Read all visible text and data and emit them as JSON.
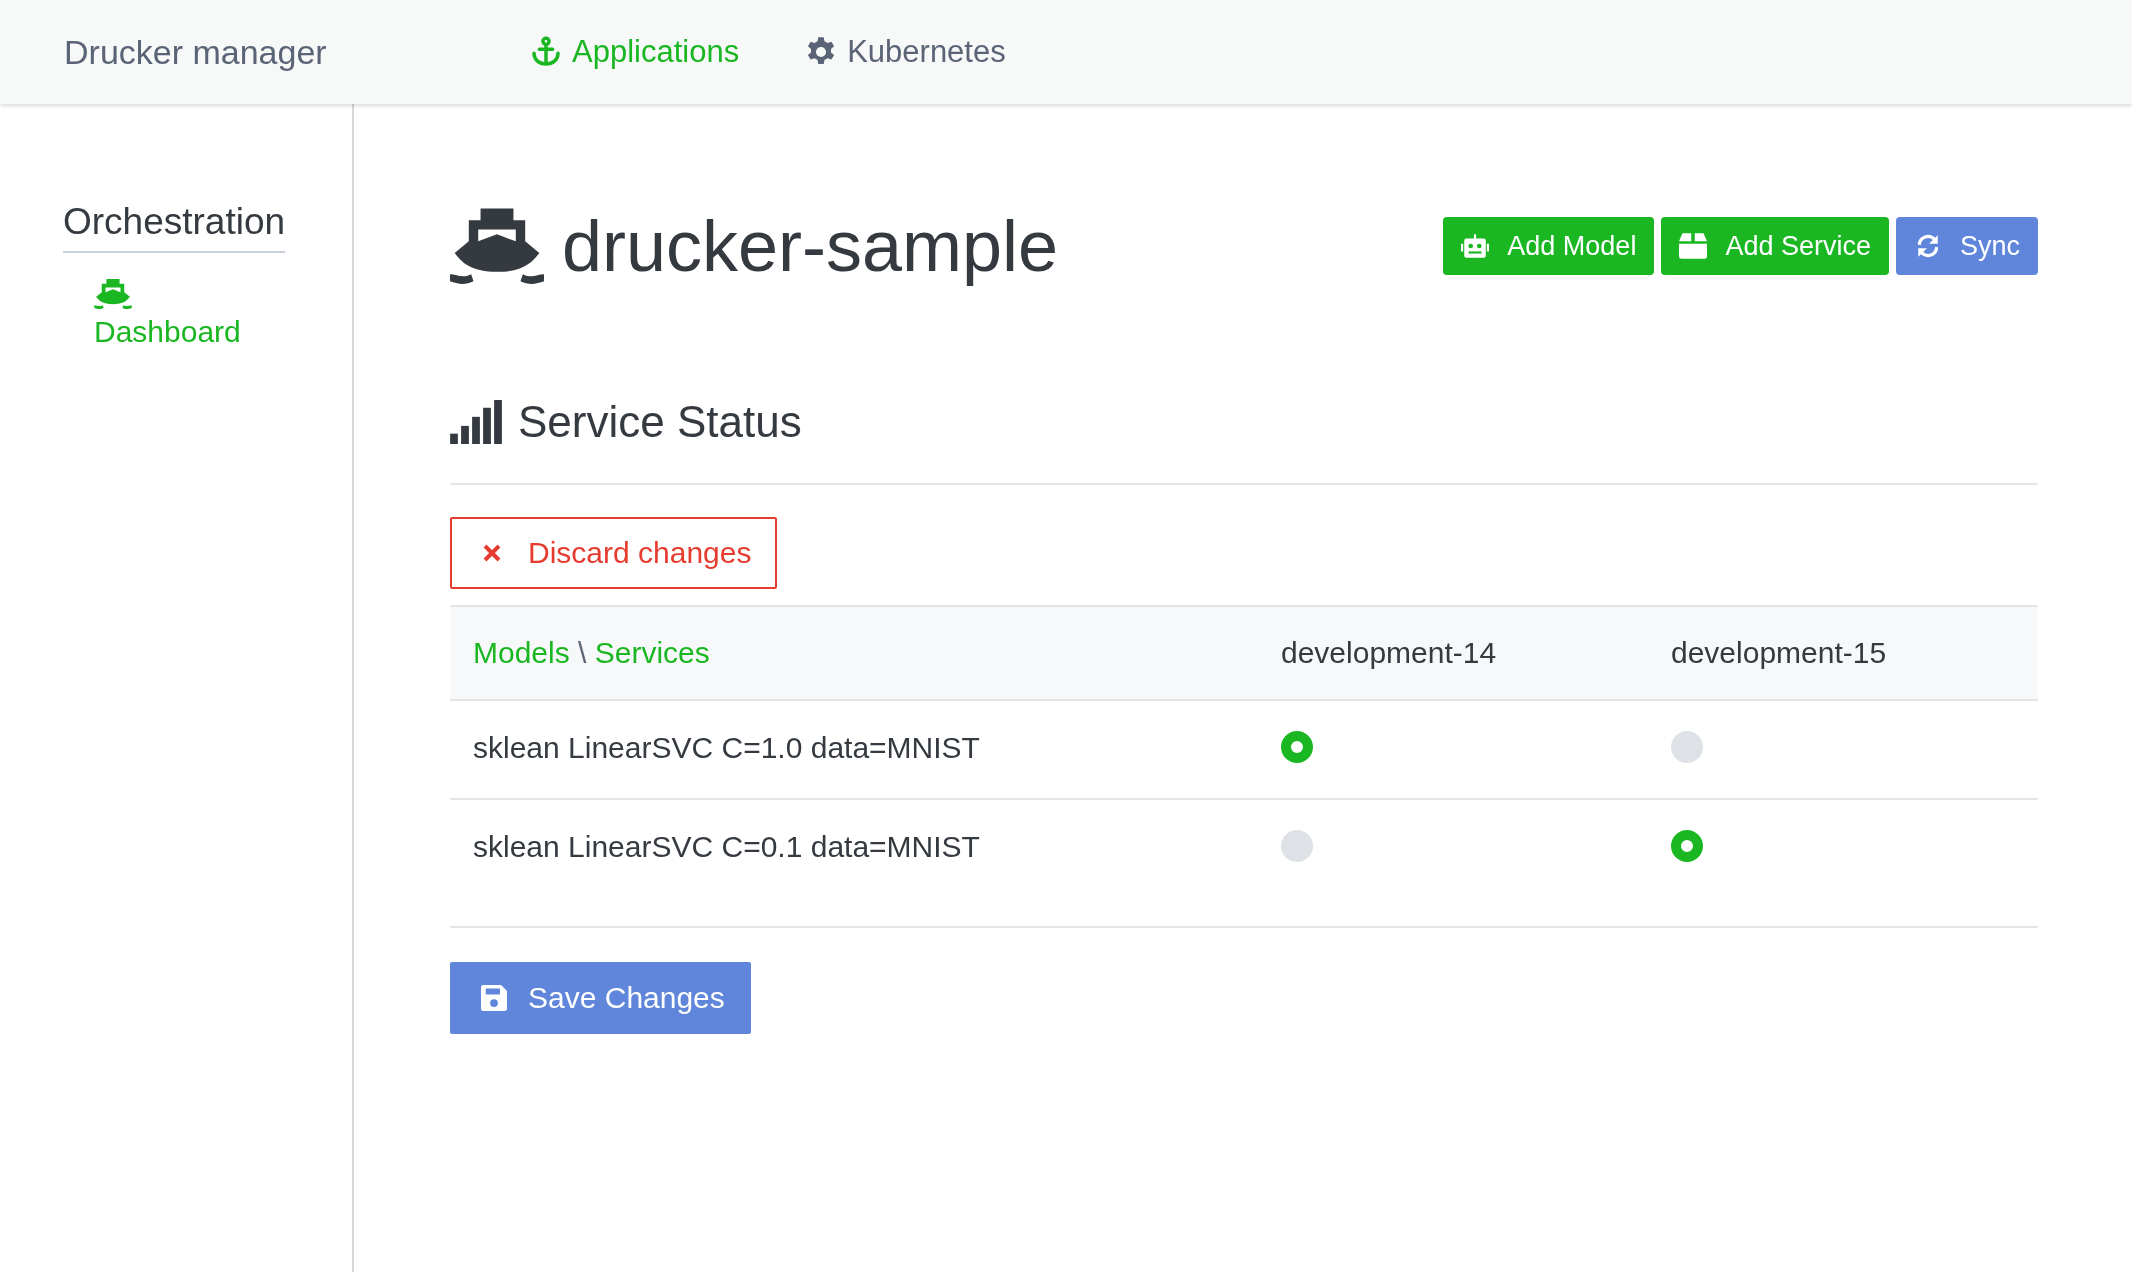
{
  "brand": "Drucker manager",
  "nav": [
    {
      "label": "Applications",
      "kind": "anchor",
      "selected": true
    },
    {
      "label": "Kubernetes",
      "kind": "gear",
      "selected": false
    }
  ],
  "sidebar": {
    "title": "Orchestration",
    "items": [
      {
        "label": "Dashboard",
        "selected": true
      }
    ]
  },
  "page": {
    "title": "drucker-sample",
    "actions": [
      {
        "label": "Add Model",
        "kind": "robot"
      },
      {
        "label": "Add Service",
        "kind": "box"
      },
      {
        "label": "Sync",
        "kind": "sync"
      }
    ]
  },
  "status": {
    "title": "Service Status",
    "discard": "Discard changes",
    "header": {
      "left": "Models",
      "separator": "\\",
      "right": "Services"
    },
    "columns": [
      "development-14",
      "development-15"
    ],
    "rows": [
      {
        "model": "sklean LinearSVC C=1.0 data=MNIST",
        "cells": [
          {
            "selected": true
          },
          {
            "selected": false
          }
        ]
      },
      {
        "model": "sklean LinearSVC C=0.1 data=MNIST",
        "cells": [
          {
            "selected": false
          },
          {
            "selected": true
          }
        ]
      }
    ],
    "save": "Save Changes"
  }
}
